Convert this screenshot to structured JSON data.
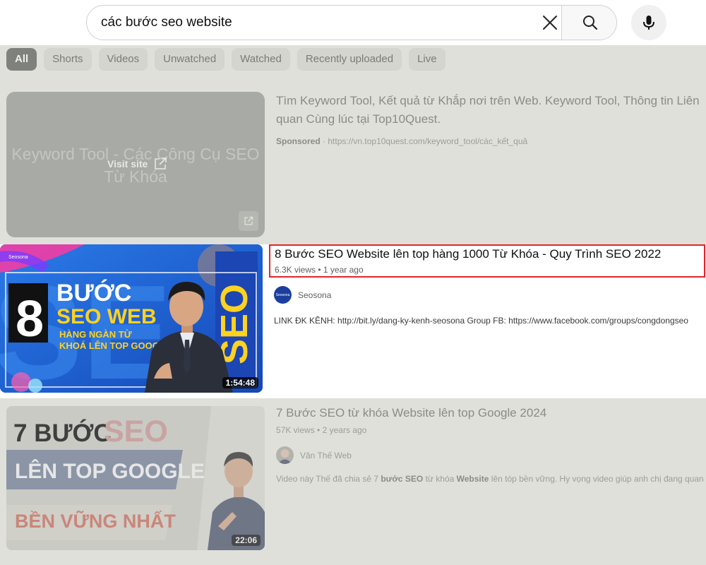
{
  "search": {
    "query": "các bước seo website"
  },
  "filters": {
    "chips": [
      "All",
      "Shorts",
      "Videos",
      "Unwatched",
      "Watched",
      "Recently uploaded",
      "Live"
    ]
  },
  "ad": {
    "thumbnail_text": "Keyword Tool - Các Công Cụ SEO Từ Khóa",
    "visit_site_label": "Visit site",
    "title": "Tìm Keyword Tool, Kết quả từ Khắp nơi trên Web. Keyword Tool, Thông tin Liên quan Cùng lúc tại Top10Quest.",
    "sponsored_label": "Sponsored",
    "url": "https://vn.top10quest.com/keyword_tool/các_kết_quả"
  },
  "results": [
    {
      "title": "8 Bước SEO Website lên top hàng 1000 Từ Khóa - Quy Trình SEO 2022",
      "views": "6.3K views",
      "age": "1 year ago",
      "channel": "Seosona",
      "channel_logo_text": "Seosona",
      "description": "LINK ĐK KÊNH: http://bit.ly/dang-ky-kenh-seosona Group FB: https://www.facebook.com/groups/congdongseo",
      "duration": "1:54:48",
      "thumbnail": {
        "brand": "Seosona",
        "number": "8",
        "line1": "BƯỚC",
        "line2": "SEO WEB",
        "line3": "HÀNG NGÀN TỪ",
        "line4": "KHOÁ LÊN TOP GOOGLE",
        "vertical": "SEO"
      },
      "highlighted": true
    },
    {
      "title": "7 Bước SEO từ khóa Website lên top Google 2024",
      "views": "57K views",
      "age": "2 years ago",
      "channel": "Văn Thế Web",
      "description_parts": [
        {
          "text": "Video này Thế đã chia sẻ 7 ",
          "bold": false
        },
        {
          "text": "bước SEO",
          "bold": true
        },
        {
          "text": " từ khóa ",
          "bold": false
        },
        {
          "text": "Website",
          "bold": true
        },
        {
          "text": " lên tóp bền vững. Hy vọng video giúp anh chị đang quan tâm",
          "bold": false
        }
      ],
      "duration": "22:06",
      "thumbnail": {
        "line1a": "7 BƯỚC",
        "line1b": "SEO",
        "line2": "LÊN TOP GOOGLE",
        "line3": "BỀN VỮNG NHẤT"
      },
      "highlighted": false
    }
  ],
  "colors": {
    "highlight_border": "#e0262a",
    "dim_overlay": "#dfe0da",
    "thumbnail_blue": "#1e63d8",
    "thumbnail_yellow": "#ffd21f"
  }
}
